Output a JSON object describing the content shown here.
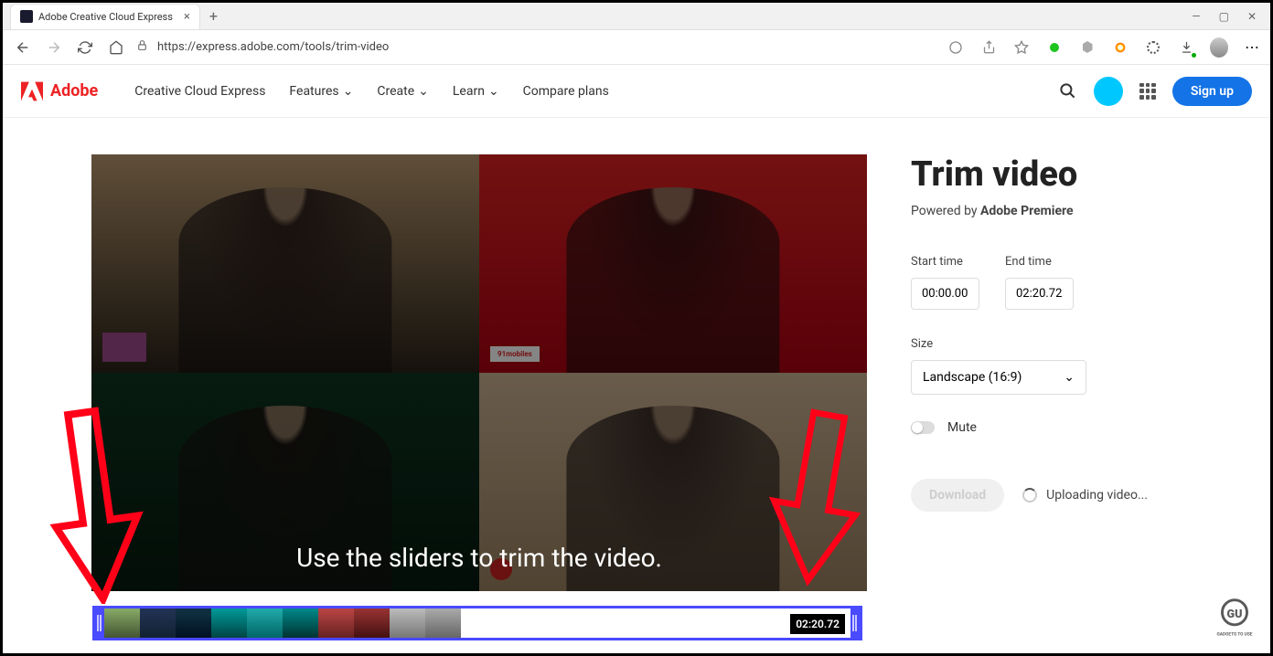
{
  "browser": {
    "tab_title": "Adobe Creative Cloud Express",
    "url": "https://express.adobe.com/tools/trim-video"
  },
  "header": {
    "brand": "Adobe",
    "nav": [
      "Creative Cloud Express",
      "Features",
      "Create",
      "Learn",
      "Compare plans"
    ],
    "signup": "Sign up"
  },
  "video": {
    "overlay_text": "Use the sliders to trim the video.",
    "badge_mobiles": "91mobiles",
    "timeline_end": "02:20.72"
  },
  "panel": {
    "title": "Trim video",
    "powered_prefix": "Powered by ",
    "powered_brand": "Adobe Premiere",
    "start_label": "Start time",
    "end_label": "End time",
    "start_value": "00:00.00",
    "end_value": "02:20.72",
    "size_label": "Size",
    "size_value": "Landscape (16:9)",
    "mute": "Mute",
    "download": "Download",
    "status": "Uploading video..."
  }
}
